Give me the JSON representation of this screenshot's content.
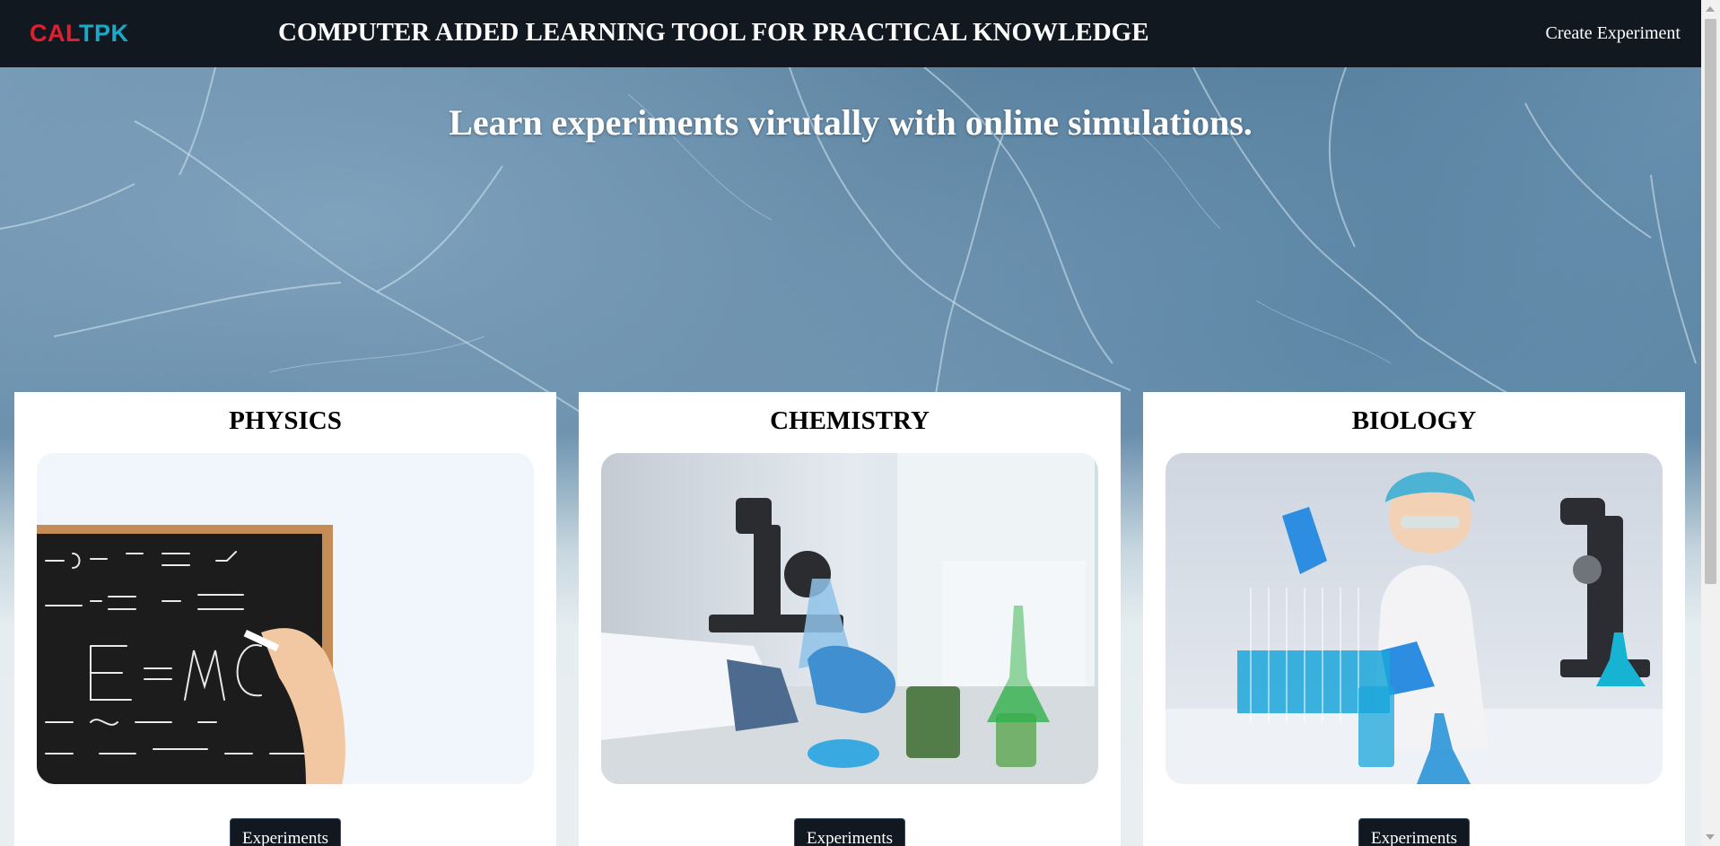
{
  "header": {
    "logo_part1": "CAL",
    "logo_part2": "TPK",
    "title": "COMPUTER AIDED LEARNING TOOL FOR PRACTICAL KNOWLEDGE",
    "nav_create": "Create Experiment"
  },
  "hero": {
    "heading": "Learn experiments virutally with online simulations."
  },
  "cards": [
    {
      "title": "PHYSICS",
      "button": "Experiments",
      "image_icon": "chalkboard-equations-image"
    },
    {
      "title": "CHEMISTRY",
      "button": "Experiments",
      "image_icon": "microscope-flask-image"
    },
    {
      "title": "BIOLOGY",
      "button": "Experiments",
      "image_icon": "scientist-lab-image"
    }
  ],
  "colors": {
    "navbar": "#111820",
    "logo_red": "#e0202e",
    "logo_blue": "#1ba9c9",
    "button": "#111820",
    "card": "#ffffff"
  }
}
